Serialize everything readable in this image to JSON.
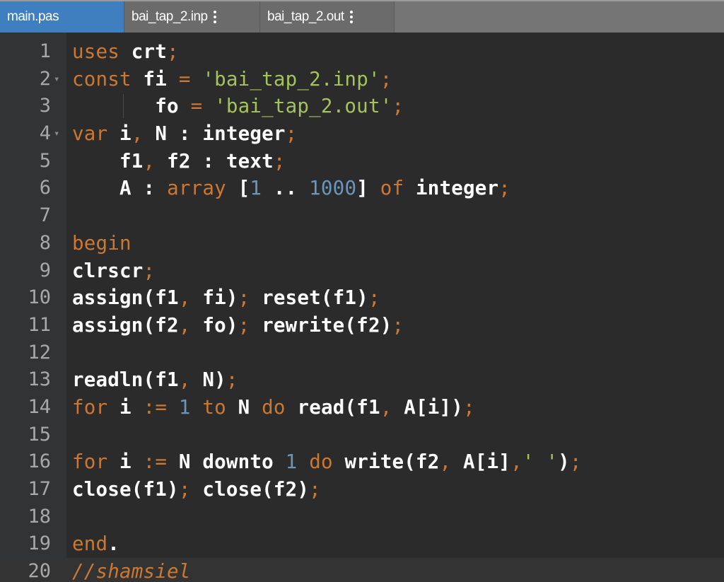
{
  "tabs": [
    {
      "label": "main.pas",
      "active": true
    },
    {
      "label": "bai_tap_2.inp",
      "active": false
    },
    {
      "label": "bai_tap_2.out",
      "active": false
    }
  ],
  "colors": {
    "keyword": "#cc7832",
    "string": "#a5c25c",
    "number": "#6897bb",
    "identifier": "#ffffff",
    "line_number": "#a8a8a8",
    "background": "#2b2b2b",
    "active_tab": "#3f7fbf"
  },
  "lines": [
    {
      "n": "1",
      "tokens": [
        [
          "kw",
          "uses"
        ],
        [
          "id",
          " crt"
        ],
        [
          "pun",
          ";"
        ]
      ]
    },
    {
      "n": "2",
      "fold": true,
      "tokens": [
        [
          "kw",
          "const"
        ],
        [
          "id",
          " fi "
        ],
        [
          "pun",
          "="
        ],
        [
          "id",
          " "
        ],
        [
          "str",
          "'bai_tap_2.inp'"
        ],
        [
          "pun",
          ";"
        ]
      ]
    },
    {
      "n": "3",
      "guide": true,
      "tokens": [
        [
          "id",
          "       fo "
        ],
        [
          "pun",
          "="
        ],
        [
          "id",
          " "
        ],
        [
          "str",
          "'bai_tap_2.out'"
        ],
        [
          "pun",
          ";"
        ]
      ]
    },
    {
      "n": "4",
      "fold": true,
      "tokens": [
        [
          "kw",
          "var"
        ],
        [
          "id",
          " i"
        ],
        [
          "pun",
          ","
        ],
        [
          "id",
          " N : integer"
        ],
        [
          "pun",
          ";"
        ]
      ]
    },
    {
      "n": "5",
      "tokens": [
        [
          "id",
          "    f1"
        ],
        [
          "pun",
          ","
        ],
        [
          "id",
          " f2 : text"
        ],
        [
          "pun",
          ";"
        ]
      ]
    },
    {
      "n": "6",
      "tokens": [
        [
          "id",
          "    A : "
        ],
        [
          "kw",
          "array"
        ],
        [
          "id",
          " ["
        ],
        [
          "num",
          "1"
        ],
        [
          "id",
          " .. "
        ],
        [
          "num",
          "1000"
        ],
        [
          "id",
          "] "
        ],
        [
          "kw",
          "of"
        ],
        [
          "id",
          " integer"
        ],
        [
          "pun",
          ";"
        ]
      ]
    },
    {
      "n": "7",
      "tokens": []
    },
    {
      "n": "8",
      "tokens": [
        [
          "kw",
          "begin"
        ]
      ]
    },
    {
      "n": "9",
      "tokens": [
        [
          "id",
          "clrscr"
        ],
        [
          "pun",
          ";"
        ]
      ]
    },
    {
      "n": "10",
      "tokens": [
        [
          "id",
          "assign(f1"
        ],
        [
          "pun",
          ","
        ],
        [
          "id",
          " fi)"
        ],
        [
          "pun",
          ";"
        ],
        [
          "id",
          " reset(f1)"
        ],
        [
          "pun",
          ";"
        ]
      ]
    },
    {
      "n": "11",
      "tokens": [
        [
          "id",
          "assign(f2"
        ],
        [
          "pun",
          ","
        ],
        [
          "id",
          " fo)"
        ],
        [
          "pun",
          ";"
        ],
        [
          "id",
          " rewrite(f2)"
        ],
        [
          "pun",
          ";"
        ]
      ]
    },
    {
      "n": "12",
      "tokens": []
    },
    {
      "n": "13",
      "tokens": [
        [
          "id",
          "readln(f1"
        ],
        [
          "pun",
          ","
        ],
        [
          "id",
          " N)"
        ],
        [
          "pun",
          ";"
        ]
      ]
    },
    {
      "n": "14",
      "tokens": [
        [
          "kw",
          "for"
        ],
        [
          "id",
          " i "
        ],
        [
          "pun",
          ":="
        ],
        [
          "id",
          " "
        ],
        [
          "num",
          "1"
        ],
        [
          "id",
          " "
        ],
        [
          "kw",
          "to"
        ],
        [
          "id",
          " N "
        ],
        [
          "kw",
          "do"
        ],
        [
          "id",
          " read(f1"
        ],
        [
          "pun",
          ","
        ],
        [
          "id",
          " A[i])"
        ],
        [
          "pun",
          ";"
        ]
      ]
    },
    {
      "n": "15",
      "tokens": []
    },
    {
      "n": "16",
      "tokens": [
        [
          "kw",
          "for"
        ],
        [
          "id",
          " i "
        ],
        [
          "pun",
          ":="
        ],
        [
          "id",
          " N downto "
        ],
        [
          "num",
          "1"
        ],
        [
          "id",
          " "
        ],
        [
          "kw",
          "do"
        ],
        [
          "id",
          " write(f2"
        ],
        [
          "pun",
          ","
        ],
        [
          "id",
          " A[i]"
        ],
        [
          "pun",
          ","
        ],
        [
          "str",
          "' '"
        ],
        [
          "id",
          ")"
        ],
        [
          "pun",
          ";"
        ]
      ]
    },
    {
      "n": "17",
      "tokens": [
        [
          "id",
          "close(f1)"
        ],
        [
          "pun",
          ";"
        ],
        [
          "id",
          " close(f2)"
        ],
        [
          "pun",
          ";"
        ]
      ]
    },
    {
      "n": "18",
      "tokens": []
    },
    {
      "n": "19",
      "tokens": [
        [
          "kw",
          "end"
        ],
        [
          "id",
          "."
        ]
      ]
    },
    {
      "n": "20",
      "current": true,
      "tokens": [
        [
          "cmt",
          "//shamsiel"
        ]
      ]
    }
  ]
}
